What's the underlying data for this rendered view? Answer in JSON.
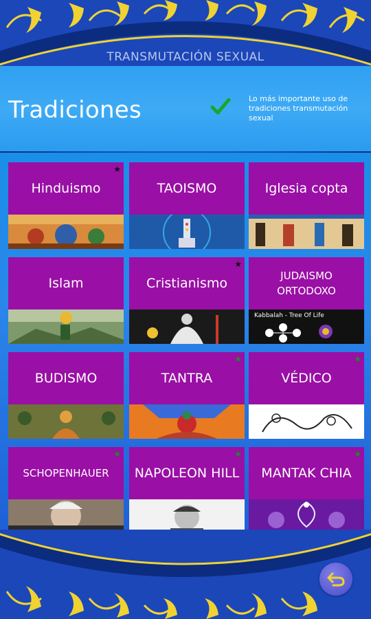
{
  "app_title": "TRANSMUTACIÓN SEXUAL",
  "header": {
    "title": "Tradiciones",
    "note": "Lo más importante uso de tradiciones transmutación sexual",
    "check_icon": "check-icon"
  },
  "tiles": [
    {
      "label": "Hinduismo",
      "star": "black",
      "image": "hinduism-image"
    },
    {
      "label": "TAOISMO",
      "star": "",
      "image": "taoism-image"
    },
    {
      "label": "Iglesia copta",
      "star": "",
      "image": "coptic-image"
    },
    {
      "label": "Islam",
      "star": "",
      "image": "islam-image"
    },
    {
      "label": "Cristianismo",
      "star": "black",
      "image": "christianity-image"
    },
    {
      "label": "JUDAISMO ORTODOXO",
      "star": "",
      "image": "judaism-image",
      "caption": "Kabbalah - Tree Of Life"
    },
    {
      "label": "BUDISMO",
      "star": "",
      "image": "buddhism-image"
    },
    {
      "label": "TANTRA",
      "star": "green",
      "image": "tantra-image"
    },
    {
      "label": "VÉDICO",
      "star": "green",
      "image": "vedic-image"
    },
    {
      "label": "SCHOPENHAUER",
      "star": "green",
      "image": "schopenhauer-image"
    },
    {
      "label": "NAPOLEON HILL",
      "star": "green",
      "image": "napoleon-hill-image"
    },
    {
      "label": "MANTAK CHIA",
      "star": "green",
      "image": "mantak-chia-image"
    }
  ],
  "back_button": {
    "icon": "undo-arrow-icon"
  },
  "colors": {
    "tile": "#9a0fa5",
    "header": "#3eaaf5",
    "ornament": "#f0d232",
    "star_green": "#1f8a2a"
  }
}
